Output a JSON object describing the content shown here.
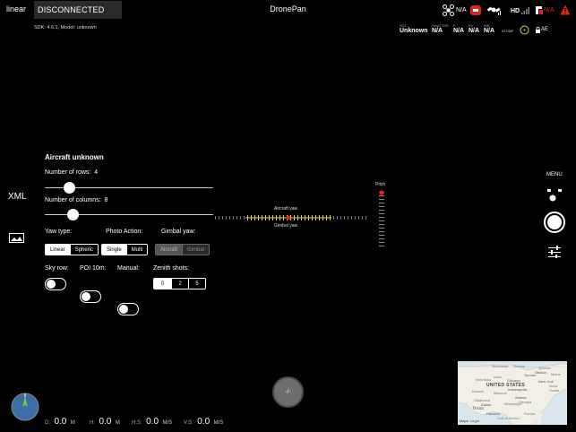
{
  "header": {
    "mode": "linear",
    "connection": "DISCONNECTED",
    "title": "DronePan",
    "sdk": "SDK: 4.6.1, Model: unknown"
  },
  "status_icons": {
    "drone_signal": "N/A",
    "hd_label": "HD",
    "battery": "N/A"
  },
  "telemetry_top": [
    {
      "label": "ISO",
      "value": "Unknown"
    },
    {
      "label": "SHUTTER",
      "value": "N/A"
    },
    {
      "label": "F",
      "value": "N/A"
    },
    {
      "label": "EV",
      "value": "N/A"
    },
    {
      "label": "WB",
      "value": "N/A"
    }
  ],
  "camera_mode": "ATOMF",
  "ae_label": "AE",
  "side_labels": {
    "xml": "XML",
    "menu": "MENU"
  },
  "panel": {
    "title": "Aircraft unknown",
    "rows_label": "Number of rows:",
    "rows_value": "4",
    "rows_fraction": 0.12,
    "cols_label": "Number of columns:",
    "cols_value": "8",
    "cols_fraction": 0.14,
    "yaw_type": {
      "label": "Yaw type:",
      "options": [
        "Linear",
        "Spheric"
      ],
      "selected": 0
    },
    "photo_action": {
      "label": "Photo Action:",
      "options": [
        "Single",
        "Multi"
      ],
      "selected": 0
    },
    "gimbal_yaw": {
      "label": "Gimbal yaw:",
      "options": [
        "Aircraft",
        "Gimbal"
      ],
      "selected": 0
    },
    "sky_row": {
      "label": "Sky row:",
      "on": false
    },
    "poi": {
      "label": "POI 10m:",
      "on": false
    },
    "manual": {
      "label": "Manual:",
      "on": false
    },
    "zenith": {
      "label": "Zenith shots:",
      "options": [
        "0",
        "2",
        "5"
      ],
      "selected": 0
    }
  },
  "indicators": {
    "aircraft_yaw": "Aircraft yaw",
    "gimbal_yaw": "Gimbal yaw",
    "pitch": "Pitch"
  },
  "center_button": "-/-",
  "telemetry_bottom": [
    {
      "label": "D:",
      "value": "0.0",
      "unit": "M"
    },
    {
      "label": "H:",
      "value": "0.0",
      "unit": "M"
    },
    {
      "label": "H.S:",
      "value": "0.0",
      "unit": "M/S"
    },
    {
      "label": "V.S:",
      "value": "0.0",
      "unit": "M/S"
    }
  ],
  "map": {
    "labels": [
      "UNITED STATES",
      "Minnesota",
      "Ontario",
      "Quebec",
      "Nebraska",
      "Iowa",
      "Kansas",
      "Missouri",
      "Oklahoma",
      "Texas",
      "Mississippi",
      "Georgia",
      "Florida",
      "Gulf of Mexico",
      "Maine",
      "Nova Scotia",
      "Chicago",
      "Toronto",
      "Ottawa",
      "New York",
      "Indianapolis",
      "Atlanta",
      "Dallas",
      "Houston",
      "Maps",
      "Legal"
    ]
  },
  "colors": {
    "accent_red": "#e0241c",
    "indicator_yellow": "#d6d24a",
    "panel_bg": "#000000"
  }
}
